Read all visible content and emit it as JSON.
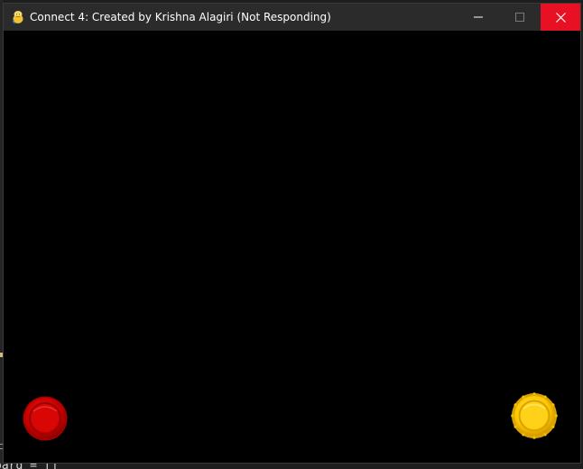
{
  "window": {
    "title": "Connect 4: Created by Krishna Alagiri (Not Responding)",
    "app_icon": "pygame-snake-icon",
    "controls": {
      "minimize": "minimize-icon",
      "maximize": "maximize-icon",
      "close": "close-icon"
    },
    "close_hover_color": "#e81123"
  },
  "game": {
    "background_color": "#000000",
    "player_one_piece": {
      "icon": "red-disc-icon",
      "color": "#d40000"
    },
    "player_two_piece": {
      "icon": "yellow-disc-icon",
      "color": "#ffcc00"
    }
  },
  "background_editor": {
    "code_fragment": "oard = []"
  }
}
